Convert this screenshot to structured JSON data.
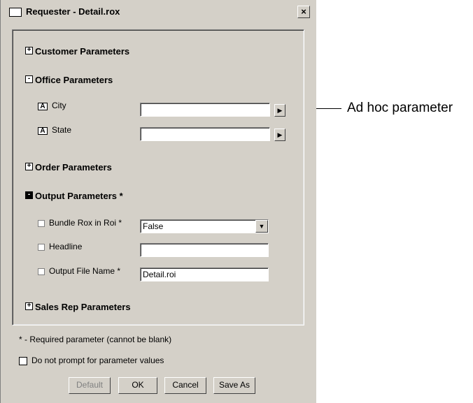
{
  "window": {
    "title": "Requester - Detail.rox",
    "close_label": "×"
  },
  "sections": {
    "customer": "Customer Parameters",
    "office": "Office Parameters",
    "order": "Order Parameters",
    "output": "Output Parameters *",
    "sales": "Sales Rep Parameters"
  },
  "office_params": {
    "city_label": "City",
    "city_value": "",
    "state_label": "State",
    "state_value": ""
  },
  "output_params": {
    "bundle_label": "Bundle Rox in Roi *",
    "bundle_value": "False",
    "headline_label": "Headline",
    "headline_value": "",
    "filename_label": "Output File Name *",
    "filename_value": "Detail.roi"
  },
  "footnote": "* - Required parameter (cannot be blank)",
  "no_prompt_label": "Do not prompt for parameter values",
  "buttons": {
    "default": "Default",
    "ok": "OK",
    "cancel": "Cancel",
    "save_as": "Save As"
  },
  "callout": "Ad hoc parameter",
  "glyphs": {
    "plus": "+",
    "minus": "-",
    "arrow_right": "▶",
    "arrow_down": "▼",
    "ad_hoc": "A"
  }
}
